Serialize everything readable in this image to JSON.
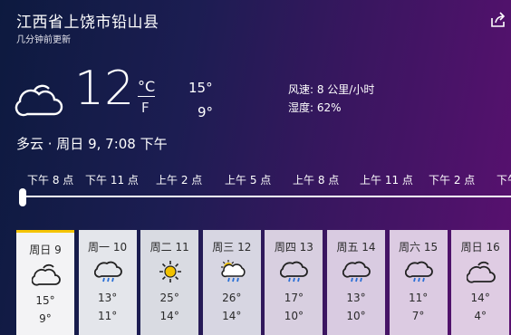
{
  "header": {
    "location": "江西省上饶市铅山县",
    "updated": "几分钟前更新"
  },
  "current": {
    "icon": "cloudy-icon",
    "temp": "12",
    "unit_c": "°C",
    "unit_f": "F",
    "high": "15°",
    "low": "9°",
    "wind": "风速: 8 公里/小时",
    "humidity": "湿度: 62%",
    "condition": "多云 · 周日 9, 7:08 下午"
  },
  "hours": [
    "下午 8 点",
    "下午 11 点",
    "上午 2 点",
    "上午 5 点",
    "上午 8 点",
    "上午 11 点",
    "下午 2 点",
    "下午"
  ],
  "days": [
    {
      "day": "周日 9",
      "icon": "cloudy-icon",
      "high": "15°",
      "low": "9°",
      "bg": "#f3f3f5"
    },
    {
      "day": "周一 10",
      "icon": "rain-cloud-icon",
      "high": "13°",
      "low": "11°",
      "bg": "#e4e6eb"
    },
    {
      "day": "周二 11",
      "icon": "sun-icon",
      "high": "25°",
      "low": "14°",
      "bg": "#d9dbe2"
    },
    {
      "day": "周三 12",
      "icon": "sun-rain-cloud-icon",
      "high": "26°",
      "low": "14°",
      "bg": "#d7d6e2"
    },
    {
      "day": "周四 13",
      "icon": "rain-cloud-icon",
      "high": "17°",
      "low": "10°",
      "bg": "#d8cfe0"
    },
    {
      "day": "周五 14",
      "icon": "rain-cloud-icon",
      "high": "13°",
      "low": "10°",
      "bg": "#d9cbe1"
    },
    {
      "day": "周六 15",
      "icon": "rain-cloud-icon",
      "high": "11°",
      "low": "7°",
      "bg": "#dccbe2"
    },
    {
      "day": "周日 16",
      "icon": "cloudy-icon",
      "high": "14°",
      "low": "4°",
      "bg": "#dfcce3"
    }
  ]
}
